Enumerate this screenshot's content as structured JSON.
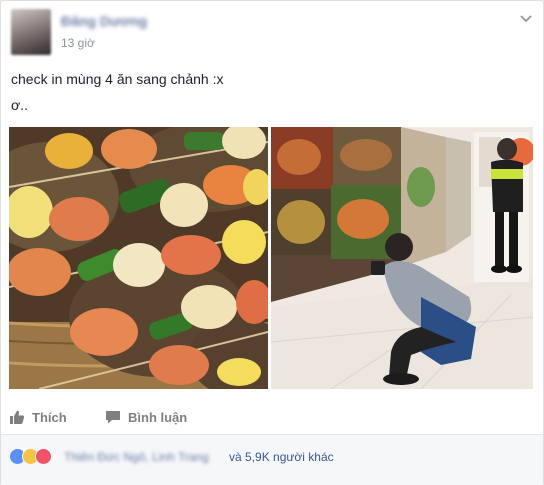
{
  "post": {
    "author": "Đăng Dương",
    "time": "13 giờ",
    "text_line1": "check in mùng 4 ăn sang chảnh :x",
    "text_line2": "ơ.."
  },
  "actions": {
    "like_label": "Thích",
    "comment_label": "Bình luận"
  },
  "reactions": {
    "names": "Thiên Đức Ngô, Linh Trang",
    "others": "và 5,9K người khác",
    "types": [
      "like",
      "haha",
      "love"
    ]
  },
  "icons": {
    "menu": "chevron-down-icon",
    "like": "thumbs-up-icon",
    "comment": "comment-icon"
  },
  "colors": {
    "link": "#365899",
    "muted": "#90949c",
    "like": "#5890ff",
    "haha": "#f7c442",
    "love": "#f25268"
  }
}
